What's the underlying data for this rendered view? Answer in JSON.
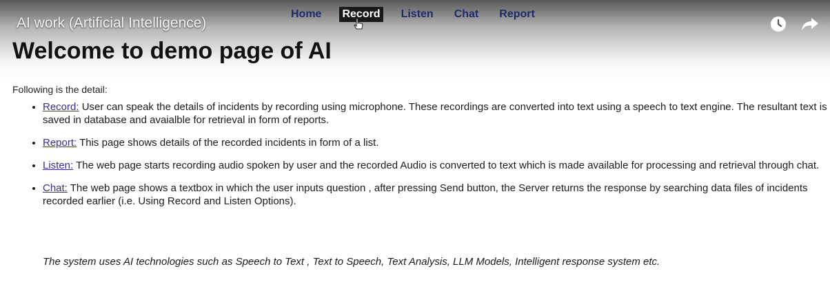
{
  "video": {
    "title": "AI work (Artificial Intelligence)",
    "controls": {
      "watch_later_icon": "clock-icon",
      "share_icon": "share-arrow-icon"
    }
  },
  "nav": {
    "items": [
      {
        "label": "Home",
        "active": false
      },
      {
        "label": "Record",
        "active": true
      },
      {
        "label": "Listen",
        "active": false
      },
      {
        "label": "Chat",
        "active": false
      },
      {
        "label": "Report",
        "active": false
      }
    ]
  },
  "page": {
    "heading": "Welcome to demo page of AI",
    "intro": "Following is the detail:",
    "items": [
      {
        "link": "Record:",
        "text": " User can speak the details of incidents by recording using microphone. These recordings are converted into text using a speech to text engine. The resultant text is saved in database and avaialble for retrieval in form of reports."
      },
      {
        "link": "Report:",
        "text": " This page shows details of the recorded incidents in form of a list."
      },
      {
        "link": "Listen:",
        "text": " The web page starts recording audio spoken by user and the recorded Audio is converted to text which is made available for processing and retrieval through chat."
      },
      {
        "link": "Chat:",
        "text": " The web page shows a textbox in which the user inputs question , after pressing Send button, the Server returns the response by searching data files of incidents recorded earlier (i.e. Using Record and Listen Options)."
      }
    ],
    "summary": "The system uses AI technologies such as Speech to Text , Text to Speech, Text Analysis, LLM Models, Intelligent response system etc."
  },
  "colors": {
    "nav_text": "#1c2b6b",
    "link": "#3a2f8a",
    "active_bg": "#1a1a1a"
  }
}
